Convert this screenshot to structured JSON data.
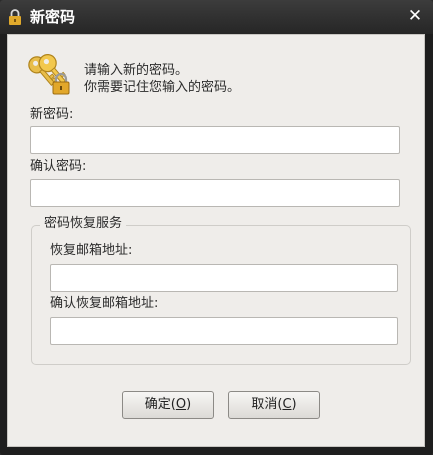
{
  "window": {
    "title": "新密码",
    "close_glyph": "✕",
    "title_icon": "lock-icon"
  },
  "info": {
    "icon": "keys-lock-icon",
    "line1": "请输入新的密码。",
    "line2": "你需要记住您输入的密码。"
  },
  "fields": {
    "new_password_label": "新密码:",
    "new_password_value": "",
    "confirm_password_label": "确认密码:",
    "confirm_password_value": ""
  },
  "recovery": {
    "group_title": "密码恢复服务",
    "email_label": "恢复邮箱地址:",
    "email_value": "",
    "confirm_email_label": "确认恢复邮箱地址:",
    "confirm_email_value": ""
  },
  "buttons": {
    "ok_prefix": "确定(",
    "ok_key": "O",
    "ok_suffix": ")",
    "cancel_prefix": "取消(",
    "cancel_key": "C",
    "cancel_suffix": ")"
  },
  "colors": {
    "titlebar": "#2e2e2e",
    "dialog_bg": "#efedea",
    "key_gold": "#e2b23a"
  }
}
